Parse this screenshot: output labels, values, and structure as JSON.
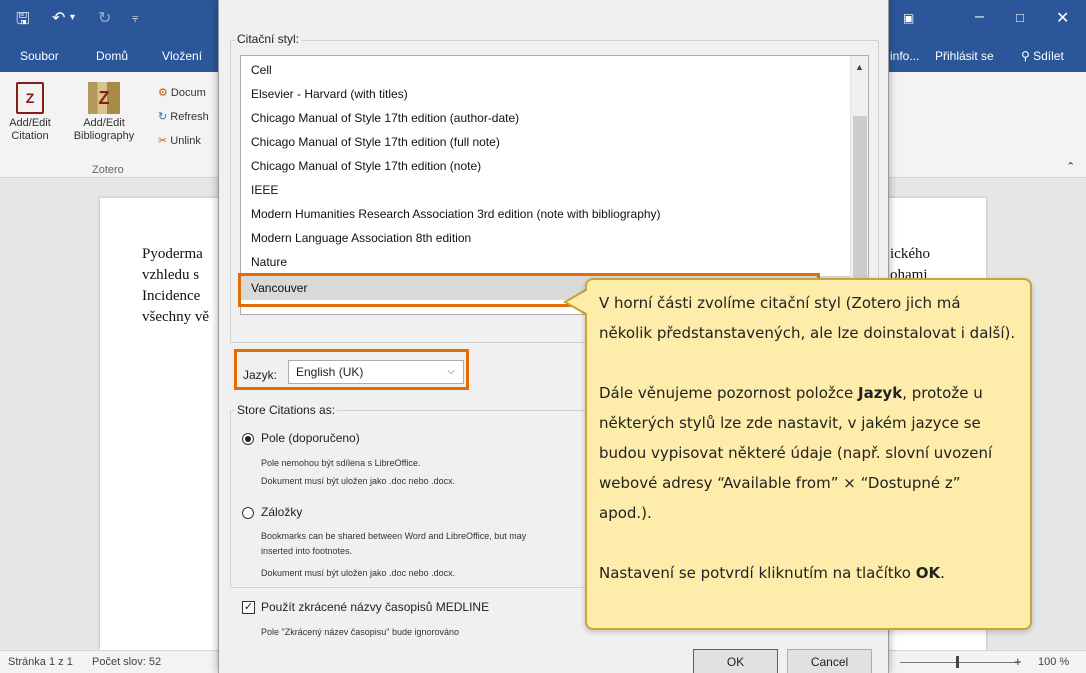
{
  "word": {
    "title_icons": [
      "save-icon",
      "undo-icon",
      "redo-icon",
      "customize-icon"
    ],
    "menu": [
      "Soubor",
      "Domů",
      "Vložení"
    ],
    "menu_right": {
      "info": "info...",
      "signin": "Přihlásit se",
      "share": "Sdílet"
    },
    "ribbon": {
      "add_citation": "Add/Edit\nCitation",
      "add_bibliography": "Add/Edit\nBibliography",
      "document": "Docum",
      "refresh": "Refresh",
      "unlink": "Unlink",
      "group": "Zotero"
    },
    "doc_lines_left": [
      "Pyoderma",
      "vzhledu s",
      "Incidence",
      "všechny vě"
    ],
    "doc_lines_right": [
      "ického",
      "ohami"
    ],
    "status": {
      "page": "Stránka 1 z 1",
      "words": "Počet slov: 52",
      "zoom": "100 %"
    }
  },
  "dialog": {
    "style_label": "Citační styl:",
    "styles": [
      "Cell",
      "Elsevier - Harvard (with titles)",
      "Chicago Manual of Style 17th edition (author-date)",
      "Chicago Manual of Style 17th edition (full note)",
      "Chicago Manual of Style 17th edition (note)",
      "IEEE",
      "Modern Humanities Research Association 3rd edition (note with bibliography)",
      "Modern Language Association 8th edition",
      "Nature",
      "Vancouver"
    ],
    "selected_style": "Vancouver",
    "language_label": "Jazyk:",
    "language_value": "English (UK)",
    "store_label": "Store Citations as:",
    "fields_option": "Pole (doporučeno)",
    "fields_note1": "Pole nemohou být sdílena s LibreOffice.",
    "fields_note2": "Dokument musí být uložen jako .doc nebo .docx.",
    "bookmarks_option": "Záložky",
    "bookmarks_note1": "Bookmarks can be shared between Word and LibreOffice, but may",
    "bookmarks_note1b": "inserted into footnotes.",
    "bookmarks_note2": "Dokument musí být uložen jako .doc nebo .docx.",
    "medline_label": "Použít zkrácené názvy časopisů MEDLINE",
    "medline_note": "Pole \"Zkrácený název časopisu\" bude ignorováno",
    "ok": "OK",
    "cancel": "Cancel"
  },
  "tooltip": {
    "p1": "V horní části zvolíme citační styl (Zotero jich má několik předstanstavených, ale lze doinstalovat i další).",
    "p2_a": "Dále věnujeme pozornost položce ",
    "p2_b": "Jazyk",
    "p2_c": ", protože u některých stylů lze zde nastavit, v jakém jazyce se budou vypisovat některé údaje (např. slovní uvození webové adresy “Available from” × “Dostupné z” apod.).",
    "p3_a": "Nastavení se potvrdí kliknutím na tlačítko ",
    "p3_b": "OK",
    "p3_c": "."
  },
  "colors": {
    "word_blue": "#2b579a",
    "highlight_orange": "#e36c09",
    "tooltip_bg": "#fdecaa"
  }
}
